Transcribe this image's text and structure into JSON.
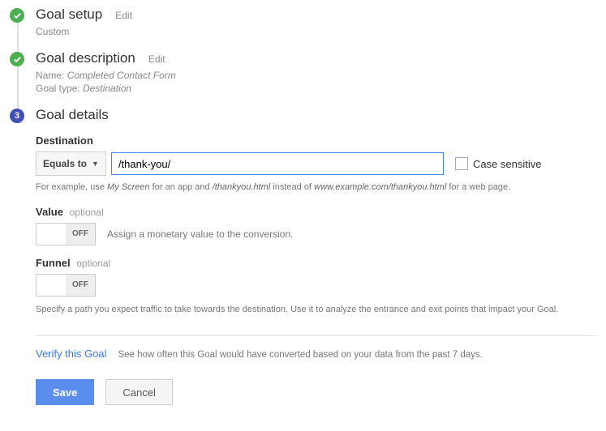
{
  "steps": {
    "setup": {
      "title": "Goal setup",
      "edit": "Edit",
      "subtitle": "Custom"
    },
    "description": {
      "title": "Goal description",
      "edit": "Edit",
      "name_label": "Name:",
      "name_value": "Completed Contact Form",
      "type_label": "Goal type:",
      "type_value": "Destination"
    },
    "details": {
      "number": "3",
      "title": "Goal details"
    }
  },
  "destination": {
    "heading": "Destination",
    "match_type": "Equals to",
    "value": "/thank-you/",
    "case_sensitive": "Case sensitive",
    "example_pre": "For example, use ",
    "example_1": "My Screen",
    "example_mid1": " for an app and ",
    "example_2": "/thankyou.html",
    "example_mid2": " instead of ",
    "example_3": "www.example.com/thankyou.html",
    "example_post": " for a web page."
  },
  "value_section": {
    "heading": "Value",
    "optional": "optional",
    "toggle": "OFF",
    "desc": "Assign a monetary value to the conversion."
  },
  "funnel_section": {
    "heading": "Funnel",
    "optional": "optional",
    "toggle": "OFF",
    "desc": "Specify a path you expect traffic to take towards the destination. Use it to analyze the entrance and exit points that impact your Goal."
  },
  "verify": {
    "link": "Verify this Goal",
    "desc": "See how often this Goal would have converted based on your data from the past 7 days."
  },
  "buttons": {
    "save": "Save",
    "cancel": "Cancel"
  }
}
